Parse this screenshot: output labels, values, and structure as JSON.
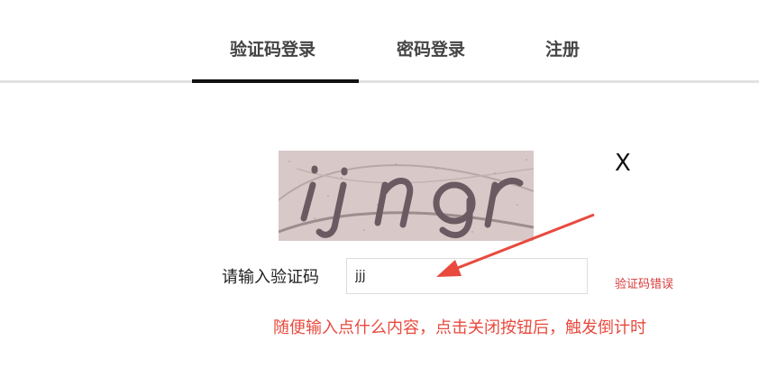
{
  "tabs": [
    {
      "label": "验证码登录",
      "active": true
    },
    {
      "label": "密码登录",
      "active": false
    },
    {
      "label": "注册",
      "active": false
    }
  ],
  "captcha": {
    "text": "ijngr"
  },
  "close_label": "X",
  "form": {
    "label": "请输入验证码",
    "input_value": "jjj",
    "error": "验证码错误"
  },
  "annotation": {
    "text": "随便输入点什么内容，点击关闭按钮后，触发倒计时",
    "color": "#e84a3e"
  }
}
